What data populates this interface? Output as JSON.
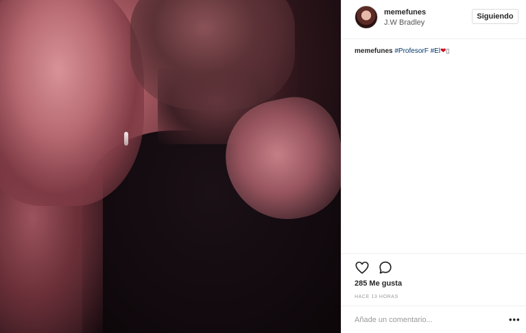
{
  "header": {
    "username": "memefunes",
    "location": "J.W Bradley",
    "follow_label": "Siguiendo"
  },
  "caption": {
    "username": "memefunes",
    "hashtag1": "#ProfesorF",
    "hashtag2": "#El",
    "heart": "❤",
    "device": "▯"
  },
  "actions": {
    "like_icon": "heart-outline-icon",
    "comment_icon": "speech-bubble-icon",
    "likes": "285 Me gusta",
    "time": "HACE 13 HORAS"
  },
  "comment": {
    "placeholder": "Añade un comentario...",
    "more": "•••"
  },
  "colors": {
    "hashtag": "#003569",
    "heart": "#d0021b",
    "border": "#efefef"
  }
}
